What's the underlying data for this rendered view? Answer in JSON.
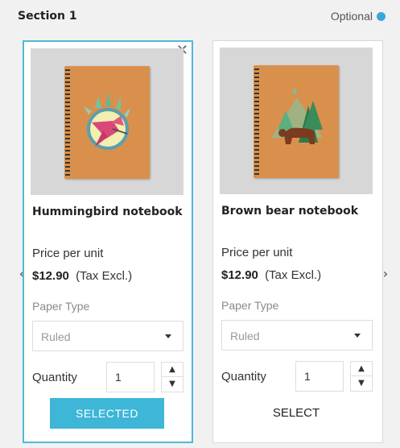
{
  "section": {
    "title": "Section 1",
    "optional_label": "Optional",
    "info_icon": "info-icon",
    "accent_color": "#3db6d8"
  },
  "carousel": {
    "prev_icon": "chevron-left-icon",
    "next_icon": "chevron-right-icon",
    "prev_glyph": "‹",
    "next_glyph": "›"
  },
  "products": [
    {
      "name": "Hummingbird notebook",
      "price_label": "Price per unit",
      "price": "$12.90",
      "tax_note": "(Tax Excl.)",
      "paper_type_label": "Paper Type",
      "paper_type_value": "Ruled",
      "quantity_label": "Quantity",
      "quantity": "1",
      "button_label": "SELECTED",
      "selected": true,
      "remove_glyph": "✕"
    },
    {
      "name": "Brown bear notebook",
      "price_label": "Price per unit",
      "price": "$12.90",
      "tax_note": "(Tax Excl.)",
      "paper_type_label": "Paper Type",
      "paper_type_value": "Ruled",
      "quantity_label": "Quantity",
      "quantity": "1",
      "button_label": "SELECT",
      "selected": false
    }
  ],
  "stepper": {
    "up_glyph": "▲",
    "down_glyph": "▼"
  }
}
